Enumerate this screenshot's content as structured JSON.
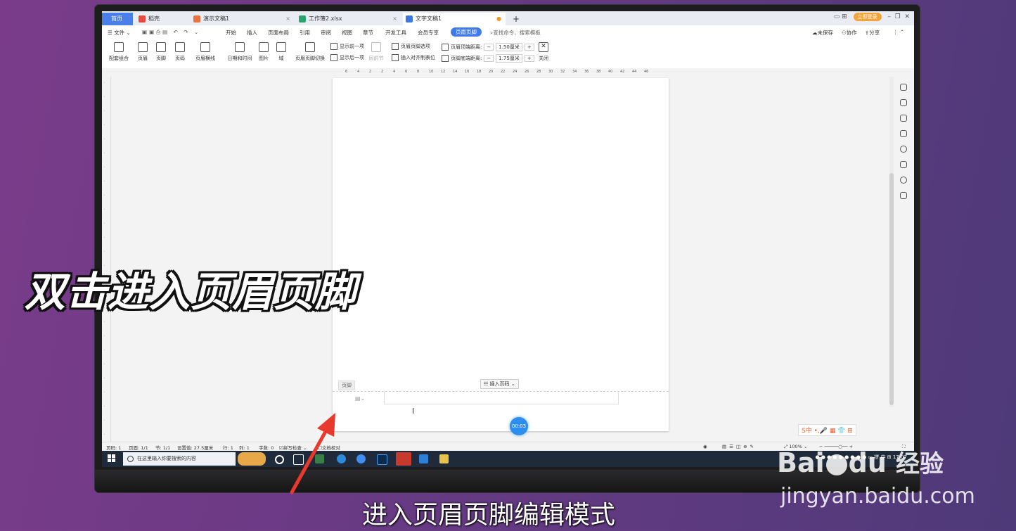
{
  "tabs": [
    {
      "label": "首页"
    },
    {
      "label": "稻壳"
    },
    {
      "label": "演示文稿1"
    },
    {
      "label": "工作簿2.xlsx"
    },
    {
      "label": "文字文稿1"
    }
  ],
  "tabbar_right": {
    "vip": "立即登录"
  },
  "menu": [
    "文件",
    "开始",
    "插入",
    "页面布局",
    "引用",
    "审阅",
    "视图",
    "章节",
    "开发工具",
    "会员专享",
    "页眉页脚"
  ],
  "menu_search": "查找命令、搜索模板",
  "menu_right": [
    "未保存",
    "协作",
    "分享"
  ],
  "ribbon": {
    "items": [
      "配套组合",
      "页眉",
      "页脚",
      "页码",
      "页眉横线",
      "日期和时间",
      "图片",
      "域",
      "页眉页脚切换",
      "同前节",
      "关闭"
    ],
    "small": [
      "显示前一项",
      "显示后一项",
      "页眉页脚选项",
      "插入对齐制表位"
    ],
    "header_top_label": "页眉顶端距离:",
    "header_top_value": "1.50厘米",
    "footer_bottom_label": "页脚底端距离:",
    "footer_bottom_value": "1.75厘米"
  },
  "ruler_top": [
    "6",
    "4",
    "2",
    "2",
    "4",
    "6",
    "8",
    "10",
    "12",
    "14",
    "16",
    "18",
    "20",
    "22",
    "24",
    "26",
    "28",
    "30",
    "32",
    "34",
    "36",
    "38",
    "40",
    "42",
    "44",
    "46"
  ],
  "document": {
    "footer_tag": "页脚",
    "insert_page_number": "插入页码"
  },
  "timer": "00:03",
  "statusbar": [
    "页码: 1",
    "页面: 1/1",
    "节: 1/1",
    "设置值: 27.5厘米",
    "行: 1",
    "列: 1",
    "字数: 0",
    "拼写检查",
    "文档校对",
    "100%"
  ],
  "taskbar": {
    "search_placeholder": "在这里输入你要搜索的内容"
  },
  "ime": "S中",
  "overlay": {
    "title": "双击进入页眉页脚",
    "subtitle": "进入页眉页脚编辑模式"
  },
  "watermark": {
    "logo": "Bai",
    "logo2": "du",
    "jingyan": "经验",
    "url": "jingyan.baidu.com"
  }
}
